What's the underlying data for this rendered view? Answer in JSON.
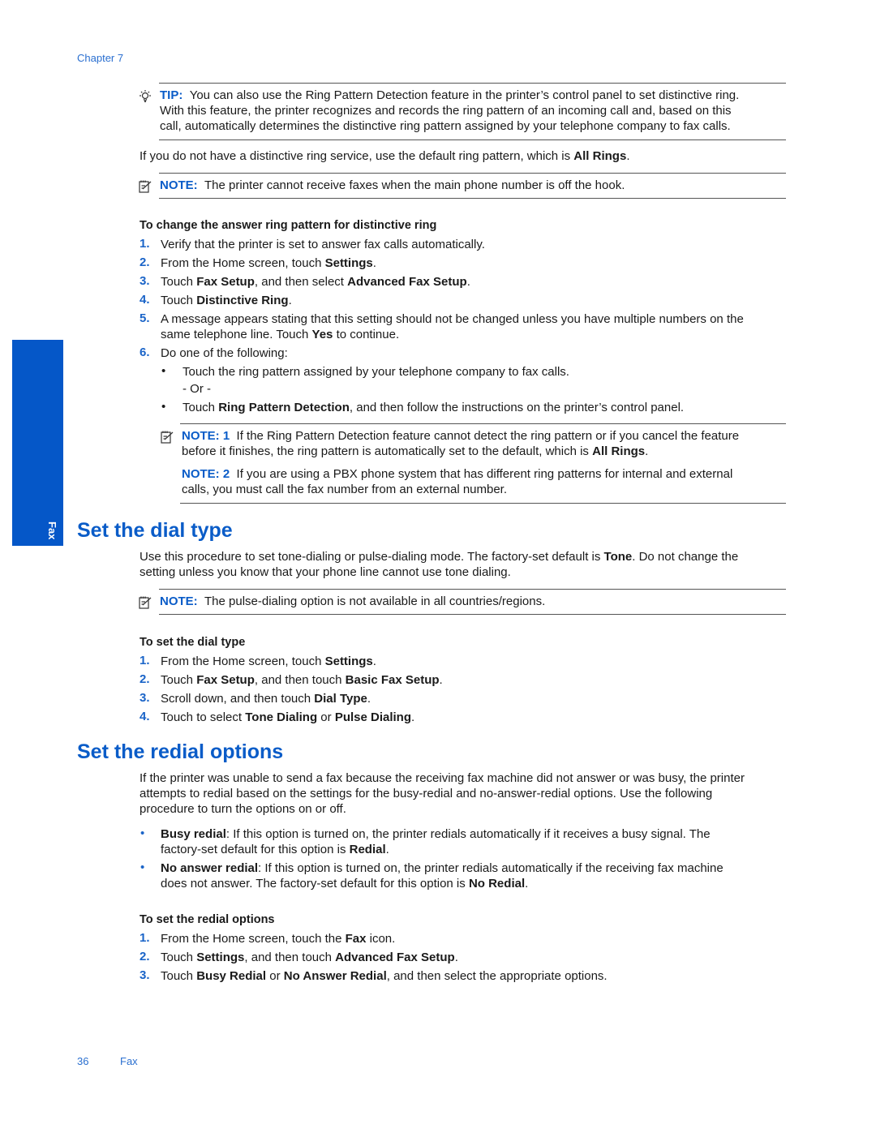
{
  "header": {
    "chapter": "Chapter 7"
  },
  "side_tab": {
    "label": "Fax",
    "color": "#0557c8"
  },
  "tip": {
    "label": "TIP:",
    "lines": [
      "You can also use the Ring Pattern Detection feature in the printer’s control panel to set distinctive ring.",
      "With this feature, the printer recognizes and records the ring pattern of an incoming call and, based on this",
      "call, automatically determines the distinctive ring pattern assigned by your telephone company to fax calls."
    ]
  },
  "intro": {
    "text": "If you do not have a distinctive ring service, use the default ring pattern, which is ",
    "bold": "All Rings",
    "end": "."
  },
  "note1": {
    "label": "NOTE:",
    "text": "The printer cannot receive faxes when the main phone number is off the hook."
  },
  "proc1": {
    "title": "To change the answer ring pattern for distinctive ring",
    "steps": [
      {
        "n": "1.",
        "parts": [
          {
            "t": "Verify that the printer is set to answer fax calls automatically."
          }
        ]
      },
      {
        "n": "2.",
        "parts": [
          {
            "t": "From the Home screen, touch "
          },
          {
            "b": "Settings"
          },
          {
            "t": "."
          }
        ]
      },
      {
        "n": "3.",
        "parts": [
          {
            "t": "Touch "
          },
          {
            "b": "Fax Setup"
          },
          {
            "t": ", and then select "
          },
          {
            "b": "Advanced Fax Setup"
          },
          {
            "t": "."
          }
        ]
      },
      {
        "n": "4.",
        "parts": [
          {
            "t": "Touch "
          },
          {
            "b": "Distinctive Ring"
          },
          {
            "t": "."
          }
        ]
      },
      {
        "n": "5.",
        "line1": "A message appears stating that this setting should not be changed unless you have multiple numbers on the",
        "line2_pre": "same telephone line. Touch ",
        "line2_bold": "Yes",
        "line2_post": " to continue."
      },
      {
        "n": "6.",
        "parts": [
          {
            "t": "Do one of the following:"
          }
        ]
      }
    ],
    "sub_bullets": {
      "first": "Touch the ring pattern assigned by your telephone company to fax calls.",
      "or": "- Or -",
      "second_pre": "Touch ",
      "second_bold": "Ring Pattern Detection",
      "second_post": ", and then follow the instructions on the printer’s control panel."
    },
    "notes": {
      "n1_label": "NOTE: 1",
      "n1_line1": "If the Ring Pattern Detection feature cannot detect the ring pattern or if you cancel the feature",
      "n1_line2_pre": "before it finishes, the ring pattern is automatically set to the default, which is ",
      "n1_line2_bold": "All Rings",
      "n1_line2_post": ".",
      "n2_label": "NOTE: 2",
      "n2_line1": "If you are using a PBX phone system that has different ring patterns for internal and external",
      "n2_line2": "calls, you must call the fax number from an external number."
    }
  },
  "dial": {
    "heading": "Set the dial type",
    "p1_pre": "Use this procedure to set tone-dialing or pulse-dialing mode. The factory-set default is ",
    "p1_bold": "Tone",
    "p1_post": ". Do not change the",
    "p2": "setting unless you know that your phone line cannot use tone dialing.",
    "note_label": "NOTE:",
    "note_text": "The pulse-dialing option is not available in all countries/regions.",
    "proc_title": "To set the dial type",
    "steps": [
      {
        "n": "1.",
        "parts": [
          {
            "t": "From the Home screen, touch "
          },
          {
            "b": "Settings"
          },
          {
            "t": "."
          }
        ]
      },
      {
        "n": "2.",
        "parts": [
          {
            "t": "Touch "
          },
          {
            "b": "Fax Setup"
          },
          {
            "t": ", and then touch "
          },
          {
            "b": "Basic Fax Setup"
          },
          {
            "t": "."
          }
        ]
      },
      {
        "n": "3.",
        "parts": [
          {
            "t": "Scroll down, and then touch "
          },
          {
            "b": "Dial Type"
          },
          {
            "t": "."
          }
        ]
      },
      {
        "n": "4.",
        "parts": [
          {
            "t": "Touch to select "
          },
          {
            "b": "Tone Dialing"
          },
          {
            "t": " or "
          },
          {
            "b": "Pulse Dialing"
          },
          {
            "t": "."
          }
        ]
      }
    ]
  },
  "redial": {
    "heading": "Set the redial options",
    "p_lines": [
      "If the printer was unable to send a fax because the receiving fax machine did not answer or was busy, the printer",
      "attempts to redial based on the settings for the busy-redial and no-answer-redial options. Use the following",
      "procedure to turn the options on or off."
    ],
    "busy_bold": "Busy redial",
    "busy_line1": ": If this option is turned on, the printer redials automatically if it receives a busy signal. The",
    "busy_line2_pre": "factory-set default for this option is ",
    "busy_line2_bold": "Redial",
    "busy_line2_post": ".",
    "noans_bold": "No answer redial",
    "noans_line1": ": If this option is turned on, the printer redials automatically if the receiving fax machine",
    "noans_line2_pre": "does not answer. The factory-set default for this option is ",
    "noans_line2_bold": "No Redial",
    "noans_line2_post": ".",
    "proc_title": "To set the redial options",
    "steps": [
      {
        "n": "1.",
        "parts": [
          {
            "t": "From the Home screen, touch the "
          },
          {
            "b": "Fax"
          },
          {
            "t": " icon."
          }
        ]
      },
      {
        "n": "2.",
        "parts": [
          {
            "t": "Touch "
          },
          {
            "b": "Settings"
          },
          {
            "t": ", and then touch "
          },
          {
            "b": "Advanced Fax Setup"
          },
          {
            "t": "."
          }
        ]
      },
      {
        "n": "3.",
        "parts": [
          {
            "t": "Touch "
          },
          {
            "b": "Busy Redial"
          },
          {
            "t": " or "
          },
          {
            "b": "No Answer Redial"
          },
          {
            "t": ", and then select the appropriate options."
          }
        ]
      }
    ]
  },
  "footer": {
    "page_number": "36",
    "section": "Fax"
  }
}
